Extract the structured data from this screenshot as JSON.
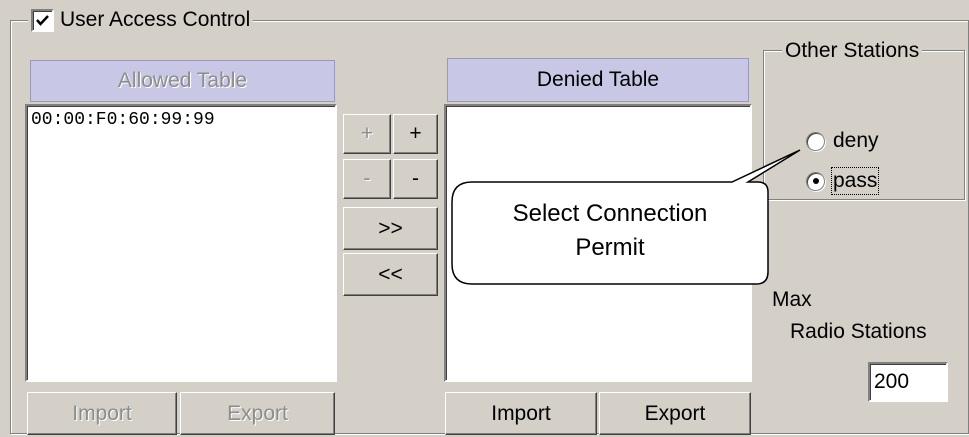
{
  "uac": {
    "checkbox_checked": true,
    "label": "User Access Control"
  },
  "allowed": {
    "header": "Allowed Table",
    "items": [
      "00:00:F0:60:99:99"
    ],
    "import_label": "Import",
    "export_label": "Export"
  },
  "middle_buttons": {
    "add_allowed": "+",
    "add_denied": "+",
    "remove_allowed": "-",
    "remove_denied": "-",
    "move_right": ">>",
    "move_left": "<<"
  },
  "denied": {
    "header": "Denied Table",
    "items": [],
    "import_label": "Import",
    "export_label": "Export"
  },
  "other_stations": {
    "label": "Other Stations",
    "options": [
      {
        "label": "deny",
        "selected": false
      },
      {
        "label": "pass",
        "selected": true
      }
    ]
  },
  "callout": {
    "line1": "Select Connection",
    "line2": "Permit"
  },
  "max_stations": {
    "label_line1": "Max",
    "label_line2": "Radio Stations",
    "value": "200"
  },
  "colors": {
    "background": "#d4d0c8",
    "table_header": "#c8c8e6",
    "disabled_text": "#8c8c8c"
  }
}
